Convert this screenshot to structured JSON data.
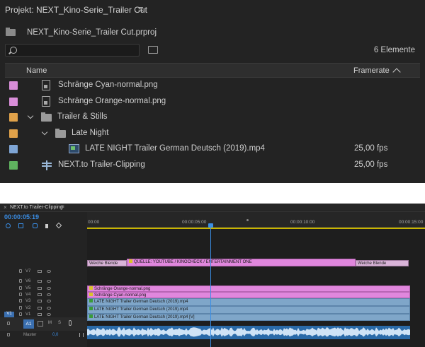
{
  "project": {
    "title": "Projekt: NEXT_Kino-Serie_Trailer Cut",
    "menu_glyph": "≡",
    "file_name": "NEXT_Kino-Serie_Trailer Cut.prproj",
    "search_placeholder": "",
    "item_count": "6 Elemente",
    "columns": {
      "name": "Name",
      "framerate": "Framerate"
    },
    "items": [
      {
        "name": "Schränge Cyan-normal.png",
        "framerate": "",
        "color": "#d98ed9",
        "icon": "image-icon",
        "indent": 0,
        "chevron": false
      },
      {
        "name": "Schränge Orange-normal.png",
        "framerate": "",
        "color": "#d98ed9",
        "icon": "image-icon",
        "indent": 0,
        "chevron": false
      },
      {
        "name": "Trailer & Stills",
        "framerate": "",
        "color": "#e0a24a",
        "icon": "folder-icon",
        "indent": 0,
        "chevron": true
      },
      {
        "name": "Late Night",
        "framerate": "",
        "color": "#e0a24a",
        "icon": "folder-icon",
        "indent": 1,
        "chevron": true
      },
      {
        "name": "LATE NIGHT Trailer German Deutsch (2019).mp4",
        "framerate": "25,00 fps",
        "color": "#7fa6d6",
        "icon": "video-icon",
        "indent": 2,
        "chevron": false
      },
      {
        "name": "NEXT.to Trailer-Clipping",
        "framerate": "25,00 fps",
        "color": "#5fb35f",
        "icon": "sequence-icon",
        "indent": 0,
        "chevron": false
      }
    ]
  },
  "timeline": {
    "tab_close": "×",
    "tab_name": "NEXT.to Trailer-Clipping",
    "tab_menu": "≡",
    "timecode": "00:00:05:19",
    "ruler_labels": [
      "00:00",
      "00:00:05:00",
      "00:00:10:00",
      "00:00:15:00"
    ],
    "video_tracks": [
      "V7",
      "V6",
      "V5",
      "V4",
      "V3",
      "V2",
      "V1"
    ],
    "source_patch": "V1",
    "clips": {
      "transition_left": "Weiche Blende",
      "transition_right": "Weiche Blende",
      "quelle": "QUELLE: YOUTUBE / KINOCHECK / ENTERTAINMENT ONE",
      "v5": "Schränge Orange-normal.png",
      "v4": "Schränge Cyan-normal.png",
      "v3": "LATE NIGHT Trailer German Deutsch (2019).mp4",
      "v2": "LATE NIGHT Trailer German Deutsch (2019).mp4",
      "v1": "LATE NIGHT Trailer German Deutsch (2019).mp4 [V]"
    },
    "audio": {
      "track": "A1",
      "m": "M",
      "s": "S"
    },
    "master": {
      "label": "Master",
      "value": "0,0"
    }
  }
}
